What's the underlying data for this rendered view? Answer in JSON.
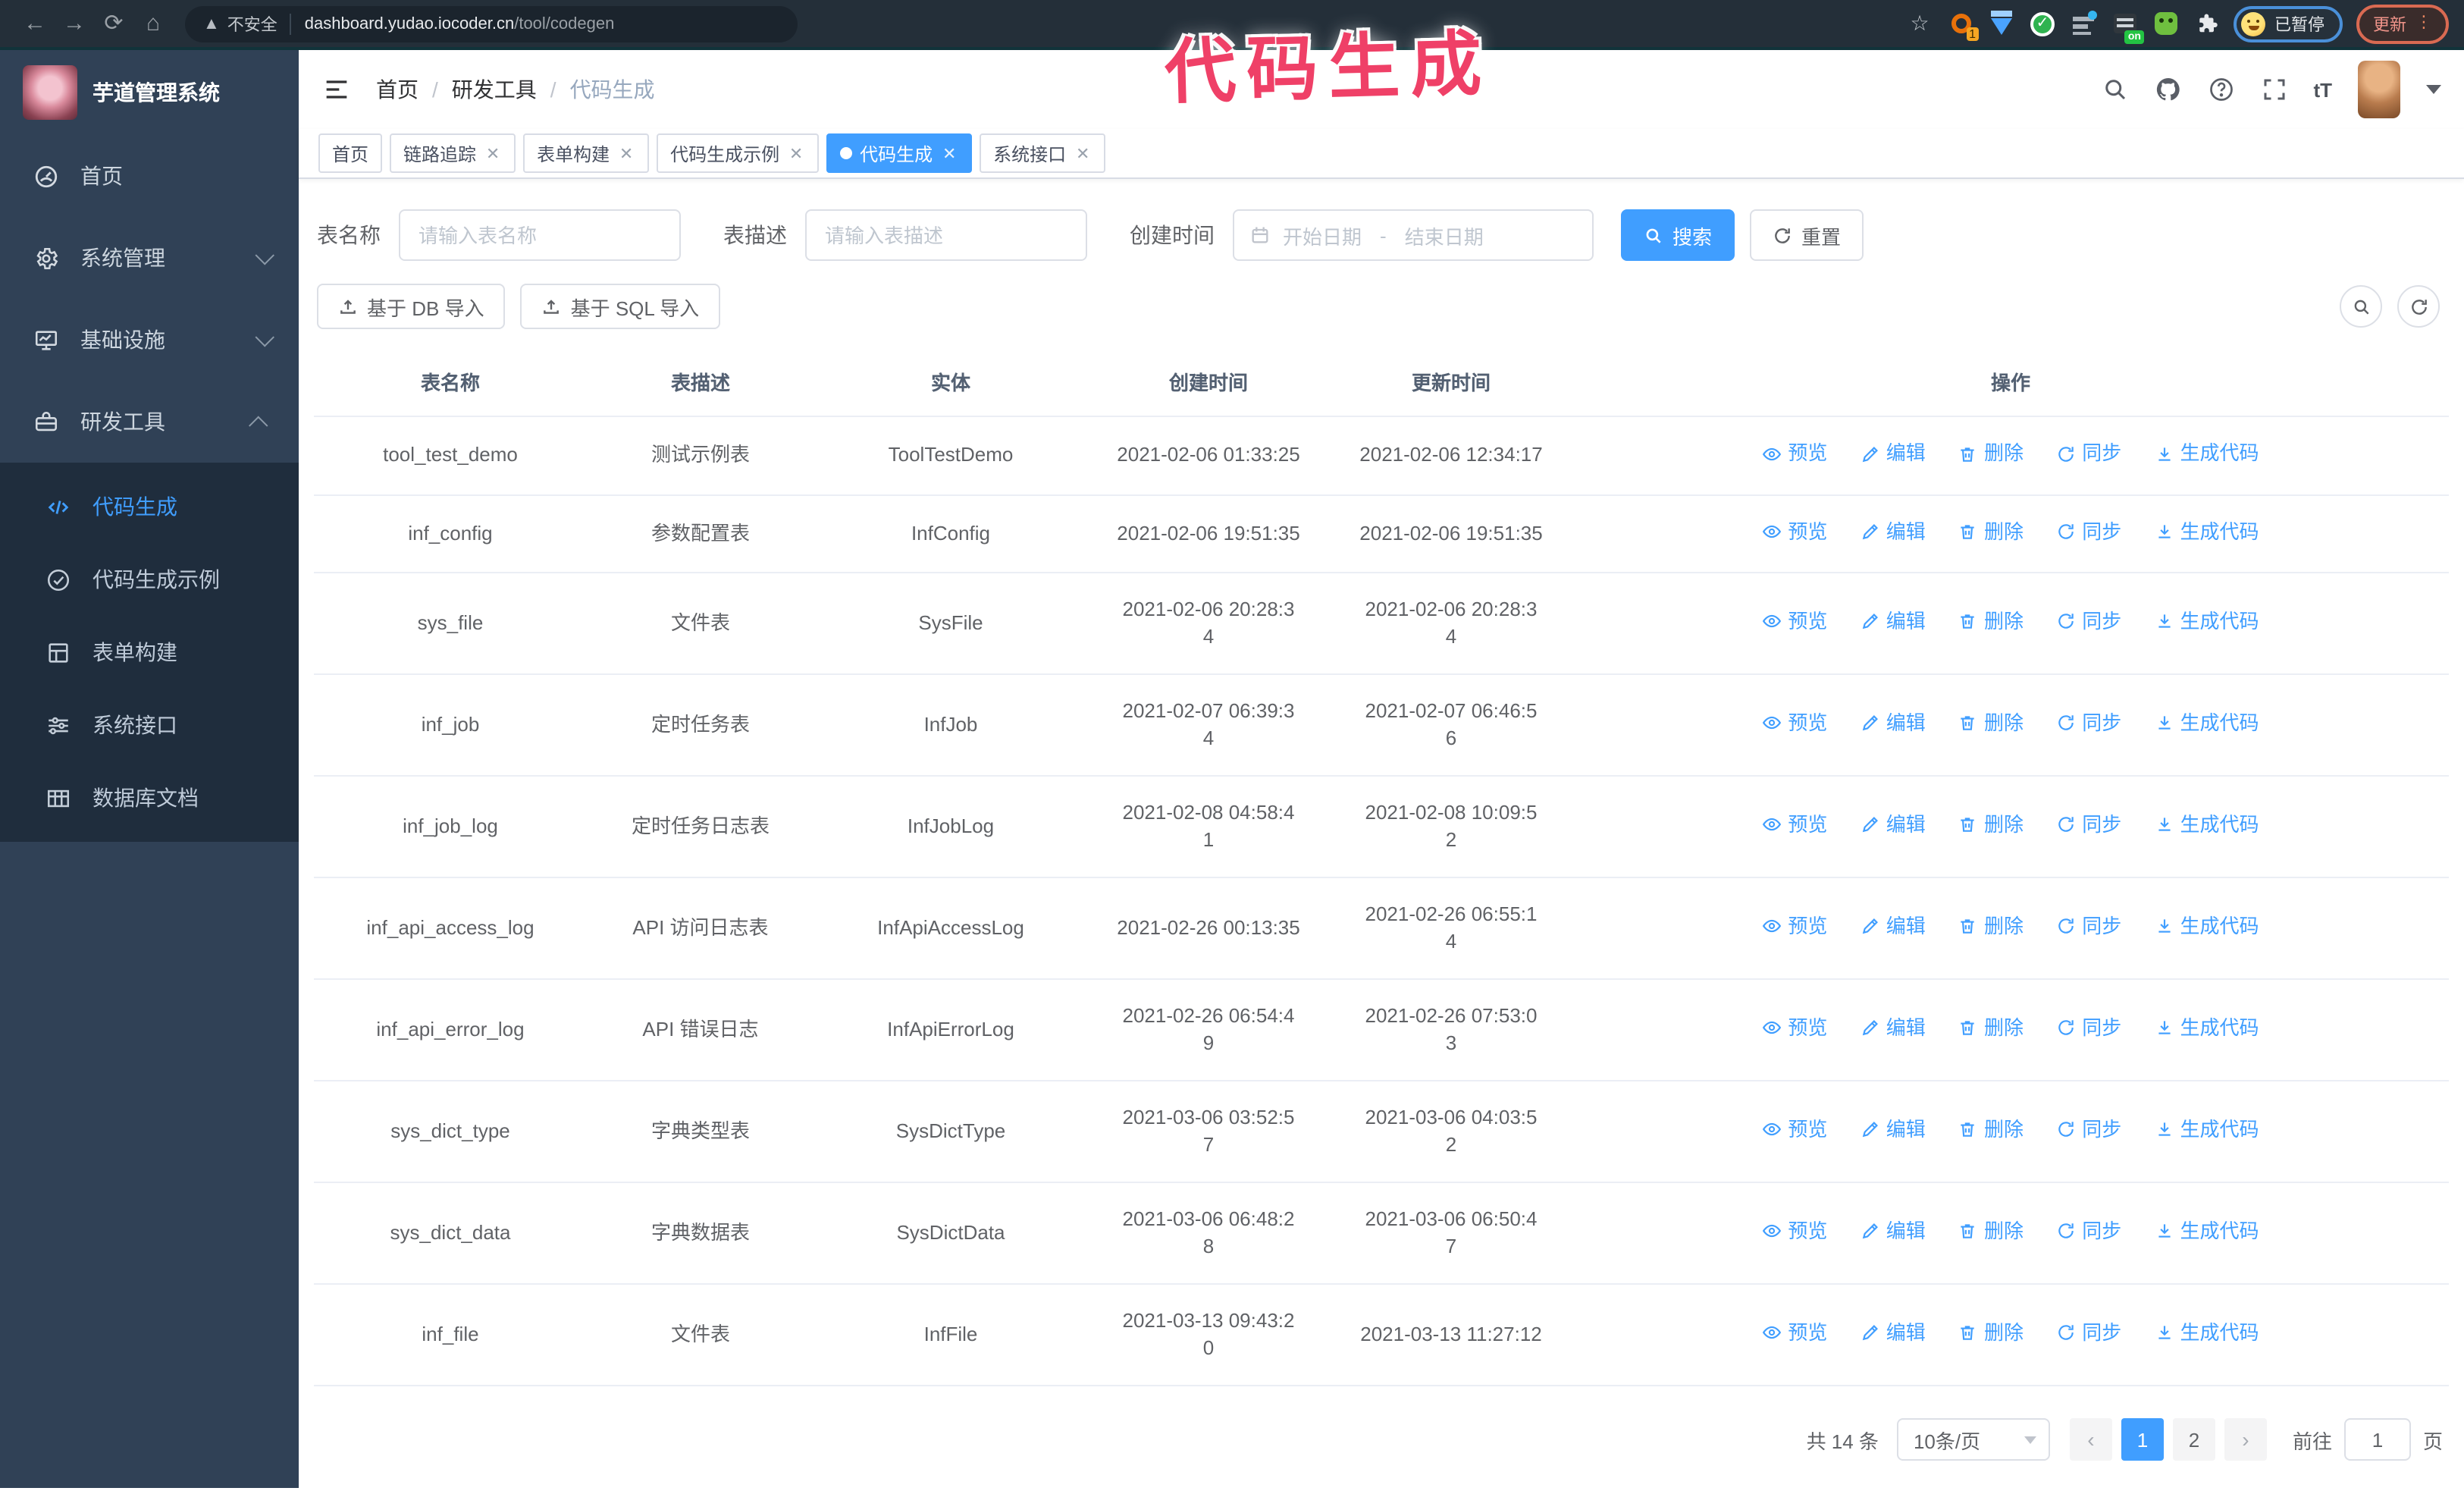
{
  "browser": {
    "security_label": "不安全",
    "url_host": "dashboard.yudao.iocoder.cn",
    "url_path": "/tool/codegen",
    "extension_badge": "1",
    "on_badge": "on",
    "paused_badge": "已暂停",
    "update_button": "更新"
  },
  "annotation": {
    "text": "代码生成",
    "color": "#ef4067"
  },
  "sidebar": {
    "title": "芋道管理系统",
    "items": [
      {
        "label": "首页"
      },
      {
        "label": "系统管理"
      },
      {
        "label": "基础设施"
      },
      {
        "label": "研发工具"
      }
    ],
    "submenu": [
      {
        "label": "代码生成",
        "active": true
      },
      {
        "label": "代码生成示例"
      },
      {
        "label": "表单构建"
      },
      {
        "label": "系统接口"
      },
      {
        "label": "数据库文档"
      }
    ]
  },
  "breadcrumb": [
    "首页",
    "研发工具",
    "代码生成"
  ],
  "tabs": [
    {
      "label": "首页",
      "closable": false,
      "active": false
    },
    {
      "label": "链路追踪",
      "closable": true,
      "active": false
    },
    {
      "label": "表单构建",
      "closable": true,
      "active": false
    },
    {
      "label": "代码生成示例",
      "closable": true,
      "active": false
    },
    {
      "label": "代码生成",
      "closable": true,
      "active": true
    },
    {
      "label": "系统接口",
      "closable": true,
      "active": false
    }
  ],
  "filters": {
    "table_name_label": "表名称",
    "table_name_placeholder": "请输入表名称",
    "table_desc_label": "表描述",
    "table_desc_placeholder": "请输入表描述",
    "create_time_label": "创建时间",
    "start_date_placeholder": "开始日期",
    "end_date_placeholder": "结束日期",
    "range_separator": "-",
    "search_button": "搜索",
    "reset_button": "重置"
  },
  "toolbar": {
    "import_db": "基于 DB 导入",
    "import_sql": "基于 SQL 导入"
  },
  "table": {
    "columns": [
      "表名称",
      "表描述",
      "实体",
      "创建时间",
      "更新时间",
      "操作"
    ],
    "actions": [
      "预览",
      "编辑",
      "删除",
      "同步",
      "生成代码"
    ],
    "rows": [
      {
        "name": "tool_test_demo",
        "desc": "测试示例表",
        "entity": "ToolTestDemo",
        "created": "2021-02-06 01:33:25",
        "updated": "2021-02-06 12:34:17"
      },
      {
        "name": "inf_config",
        "desc": "参数配置表",
        "entity": "InfConfig",
        "created": "2021-02-06 19:51:35",
        "updated": "2021-02-06 19:51:35"
      },
      {
        "name": "sys_file",
        "desc": "文件表",
        "entity": "SysFile",
        "created": "2021-02-06 20:28:3\n4",
        "updated": "2021-02-06 20:28:3\n4"
      },
      {
        "name": "inf_job",
        "desc": "定时任务表",
        "entity": "InfJob",
        "created": "2021-02-07 06:39:3\n4",
        "updated": "2021-02-07 06:46:5\n6"
      },
      {
        "name": "inf_job_log",
        "desc": "定时任务日志表",
        "entity": "InfJobLog",
        "created": "2021-02-08 04:58:4\n1",
        "updated": "2021-02-08 10:09:5\n2"
      },
      {
        "name": "inf_api_access_log",
        "desc": "API 访问日志表",
        "entity": "InfApiAccessLog",
        "created": "2021-02-26 00:13:35",
        "updated": "2021-02-26 06:55:1\n4"
      },
      {
        "name": "inf_api_error_log",
        "desc": "API 错误日志",
        "entity": "InfApiErrorLog",
        "created": "2021-02-26 06:54:4\n9",
        "updated": "2021-02-26 07:53:0\n3"
      },
      {
        "name": "sys_dict_type",
        "desc": "字典类型表",
        "entity": "SysDictType",
        "created": "2021-03-06 03:52:5\n7",
        "updated": "2021-03-06 04:03:5\n2"
      },
      {
        "name": "sys_dict_data",
        "desc": "字典数据表",
        "entity": "SysDictData",
        "created": "2021-03-06 06:48:2\n8",
        "updated": "2021-03-06 06:50:4\n7"
      },
      {
        "name": "inf_file",
        "desc": "文件表",
        "entity": "InfFile",
        "created": "2021-03-13 09:43:2\n0",
        "updated": "2021-03-13 11:27:12"
      }
    ]
  },
  "pagination": {
    "total": "共 14 条",
    "page_size": "10条/页",
    "prev": "‹",
    "next": "›",
    "pages": [
      {
        "label": "1",
        "active": true
      },
      {
        "label": "2",
        "active": false
      }
    ],
    "goto_label": "前往",
    "goto_value": "1",
    "page_suffix": "页"
  }
}
